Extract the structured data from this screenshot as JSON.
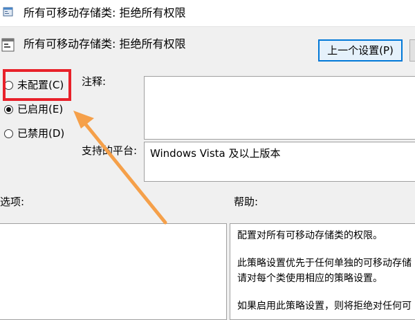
{
  "window": {
    "title": "所有可移动存储类: 拒绝所有权限"
  },
  "header": {
    "policy_name": "所有可移动存储类: 拒绝所有权限"
  },
  "buttons": {
    "prev_setting": "上一个设置(P)"
  },
  "radios": [
    {
      "label": "未配置(C)",
      "checked": false
    },
    {
      "label": "已启用(E)",
      "checked": true
    },
    {
      "label": "已禁用(D)",
      "checked": false
    }
  ],
  "fields": {
    "comment_label": "注释:",
    "platform_label": "支持的平台:",
    "platform_value": "Windows Vista 及以上版本",
    "options_label": "选项:",
    "help_label": "帮助:"
  },
  "help": {
    "lines": [
      "配置对所有可移动存储类的权限。",
      "此策略设置优先于任何单独的可移动存储",
      "请对每个类使用相应的策略设置。",
      "如果启用此策略设置，则将拒绝对任何可"
    ]
  },
  "colors": {
    "highlight_box": "#e8212a",
    "annotation_arrow": "#f5a04a",
    "focus_border": "#0078d7"
  }
}
